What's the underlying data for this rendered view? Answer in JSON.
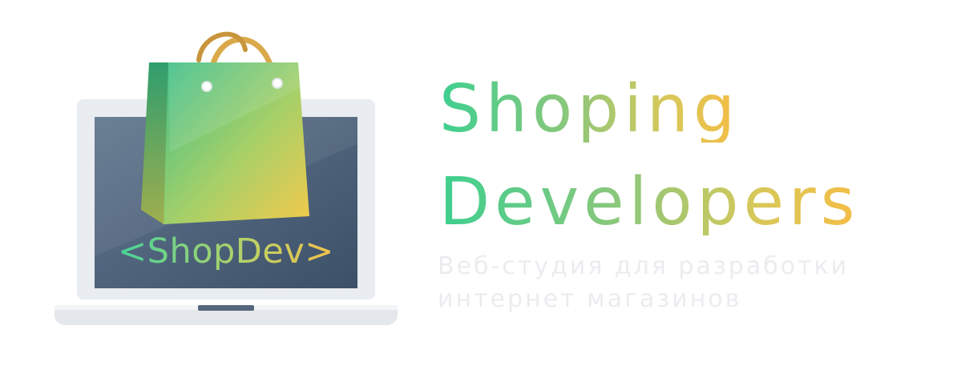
{
  "logo": {
    "screen_text": "<ShopDev>",
    "icon": "shopping-bag-on-laptop"
  },
  "brand": {
    "title_line1": "Shoping",
    "title_line2": "Developers",
    "subtitle_line1": "Веб-студия для разработки",
    "subtitle_line2": "интернет магазинов"
  },
  "colors": {
    "gradient_start": "#3ecf90",
    "gradient_end": "#f4bd45",
    "laptop_frame": "#e9ecf0",
    "screen": "#475b73",
    "subtitle": "#ececf0"
  }
}
